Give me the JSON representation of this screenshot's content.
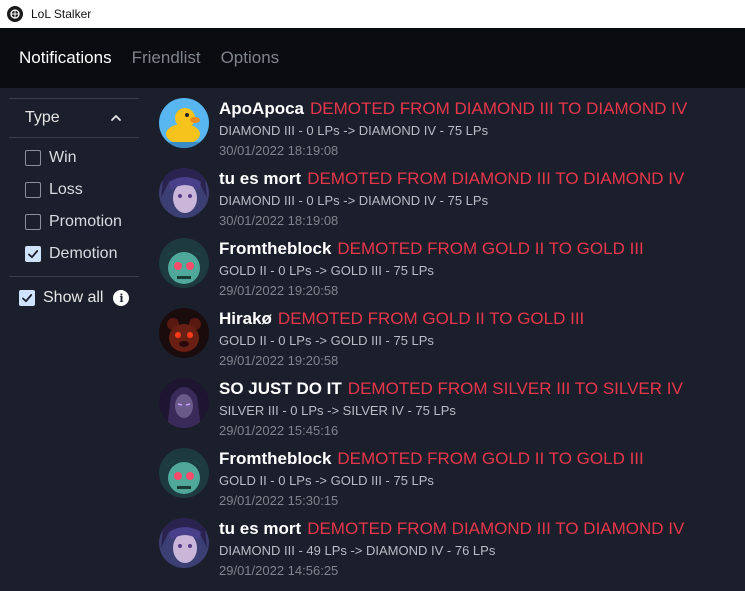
{
  "window": {
    "title": "LoL Stalker"
  },
  "nav": {
    "tabs": [
      "Notifications",
      "Friendlist",
      "Options"
    ],
    "active": 0
  },
  "filter": {
    "title": "Type",
    "items": [
      {
        "label": "Win",
        "checked": false
      },
      {
        "label": "Loss",
        "checked": false
      },
      {
        "label": "Promotion",
        "checked": false
      },
      {
        "label": "Demotion",
        "checked": true
      }
    ],
    "show_all_label": "Show all",
    "show_all_checked": true
  },
  "notifications": [
    {
      "name": "ApoApoca",
      "event": "DEMOTED FROM DIAMOND III TO DIAMOND IV",
      "detail": "DIAMOND III - 0 LPs -> DIAMOND IV - 75 LPs",
      "time": "30/01/2022 18:19:08",
      "avatar": "duck-avatar-icon"
    },
    {
      "name": "tu es mort",
      "event": "DEMOTED FROM DIAMOND III TO DIAMOND IV",
      "detail": "DIAMOND III - 0 LPs -> DIAMOND IV - 75 LPs",
      "time": "30/01/2022 18:19:08",
      "avatar": "champion-avatar-icon"
    },
    {
      "name": "Fromtheblock",
      "event": "DEMOTED FROM GOLD II TO GOLD III",
      "detail": "GOLD II - 0 LPs -> GOLD III - 75 LPs",
      "time": "29/01/2022 19:20:58",
      "avatar": "zombie-avatar-icon"
    },
    {
      "name": "Hirakø",
      "event": "DEMOTED FROM GOLD II TO GOLD III",
      "detail": "GOLD II - 0 LPs -> GOLD III - 75 LPs",
      "time": "29/01/2022 19:20:58",
      "avatar": "bear-avatar-icon"
    },
    {
      "name": "SO JUST DO IT",
      "event": "DEMOTED FROM SILVER III TO SILVER IV",
      "detail": "SILVER III - 0 LPs -> SILVER IV - 75 LPs",
      "time": "29/01/2022 15:45:16",
      "avatar": "shadow-avatar-icon"
    },
    {
      "name": "Fromtheblock",
      "event": "DEMOTED FROM GOLD II TO GOLD III",
      "detail": "GOLD II - 0 LPs -> GOLD III - 75 LPs",
      "time": "29/01/2022 15:30:15",
      "avatar": "zombie-avatar-icon"
    },
    {
      "name": "tu es mort",
      "event": "DEMOTED FROM DIAMOND III TO DIAMOND IV",
      "detail": "DIAMOND III - 49 LPs -> DIAMOND IV - 76 LPs",
      "time": "29/01/2022 14:56:25",
      "avatar": "champion-avatar-icon"
    }
  ],
  "colors": {
    "accent_red": "#e8364a",
    "background": "#1b1f2b",
    "navbar": "#0a0c12"
  }
}
